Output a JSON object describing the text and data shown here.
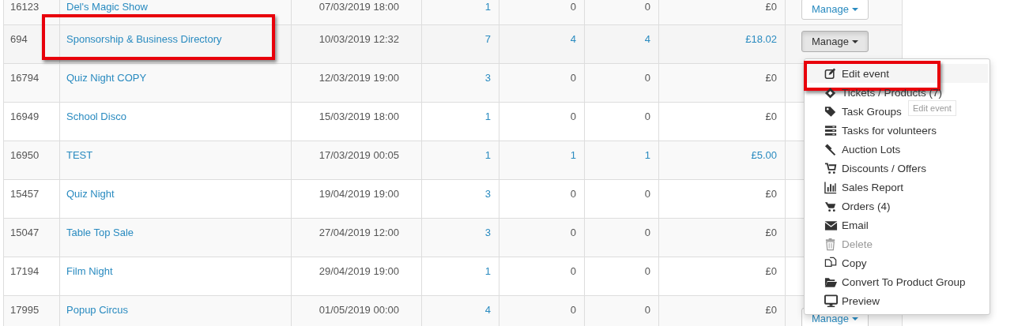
{
  "table": {
    "rows": [
      {
        "id": "16123",
        "name": "Del's Magic Show",
        "date": "07/03/2019 18:00",
        "counts": [
          {
            "text": "1",
            "link": true
          },
          {
            "text": "0",
            "link": false
          },
          {
            "text": "0",
            "link": false
          }
        ],
        "amount": {
          "text": "£0",
          "link": false
        },
        "hovered": false,
        "annotated": false,
        "manage": {
          "label": "Manage",
          "open": false
        }
      },
      {
        "id": "694",
        "name": "Sponsorship & Business Directory",
        "date": "10/03/2019 12:32",
        "counts": [
          {
            "text": "7",
            "link": true
          },
          {
            "text": "4",
            "link": true
          },
          {
            "text": "4",
            "link": true
          }
        ],
        "amount": {
          "text": "£18.02",
          "link": true
        },
        "hovered": true,
        "annotated": true,
        "manage": {
          "label": "Manage",
          "open": true
        }
      },
      {
        "id": "16794",
        "name": "Quiz Night COPY",
        "date": "12/03/2019 19:00",
        "counts": [
          {
            "text": "3",
            "link": true
          },
          {
            "text": "0",
            "link": false
          },
          {
            "text": "0",
            "link": false
          }
        ],
        "amount": {
          "text": "£0",
          "link": false
        },
        "hovered": false,
        "annotated": false
      },
      {
        "id": "16949",
        "name": "School Disco",
        "date": "15/03/2019 18:00",
        "counts": [
          {
            "text": "1",
            "link": true
          },
          {
            "text": "0",
            "link": false
          },
          {
            "text": "0",
            "link": false
          }
        ],
        "amount": {
          "text": "£0",
          "link": false
        },
        "hovered": false,
        "annotated": false
      },
      {
        "id": "16950",
        "name": "TEST",
        "date": "17/03/2019 00:05",
        "counts": [
          {
            "text": "1",
            "link": true
          },
          {
            "text": "1",
            "link": true
          },
          {
            "text": "1",
            "link": true
          }
        ],
        "amount": {
          "text": "£5.00",
          "link": true
        },
        "hovered": false,
        "annotated": false
      },
      {
        "id": "15457",
        "name": "Quiz Night",
        "date": "19/04/2019 19:00",
        "counts": [
          {
            "text": "3",
            "link": true
          },
          {
            "text": "0",
            "link": false
          },
          {
            "text": "0",
            "link": false
          }
        ],
        "amount": {
          "text": "£0",
          "link": false
        },
        "hovered": false,
        "annotated": false
      },
      {
        "id": "15047",
        "name": "Table Top Sale",
        "date": "27/04/2019 12:00",
        "counts": [
          {
            "text": "3",
            "link": true
          },
          {
            "text": "0",
            "link": false
          },
          {
            "text": "0",
            "link": false
          }
        ],
        "amount": {
          "text": "£0",
          "link": false
        },
        "hovered": false,
        "annotated": false
      },
      {
        "id": "17194",
        "name": "Film Night",
        "date": "29/04/2019 19:00",
        "counts": [
          {
            "text": "1",
            "link": true
          },
          {
            "text": "0",
            "link": false
          },
          {
            "text": "0",
            "link": false
          }
        ],
        "amount": {
          "text": "£0",
          "link": false
        },
        "hovered": false,
        "annotated": false
      },
      {
        "id": "17995",
        "name": "Popup Circus",
        "date": "01/05/2019 00:00",
        "counts": [
          {
            "text": "4",
            "link": true
          },
          {
            "text": "0",
            "link": false
          },
          {
            "text": "0",
            "link": false
          }
        ],
        "amount": {
          "text": "£0",
          "link": false
        },
        "hovered": false,
        "annotated": false,
        "manage": {
          "label": "Manage",
          "open": false
        }
      }
    ]
  },
  "menu": {
    "items": [
      {
        "label": "Edit event",
        "selected": true,
        "disabled": false,
        "annotated": true
      },
      {
        "label": "Tickets / Products (7)",
        "selected": false,
        "disabled": false,
        "annotated": false
      },
      {
        "label": "Task Groups",
        "selected": false,
        "disabled": false,
        "annotated": false
      },
      {
        "label": "Tasks for volunteers",
        "selected": false,
        "disabled": false,
        "annotated": false
      },
      {
        "label": "Auction Lots",
        "selected": false,
        "disabled": false,
        "annotated": false
      },
      {
        "label": "Discounts / Offers",
        "selected": false,
        "disabled": false,
        "annotated": false
      },
      {
        "label": "Sales Report",
        "selected": false,
        "disabled": false,
        "annotated": false
      },
      {
        "label": "Orders (4)",
        "selected": false,
        "disabled": false,
        "annotated": false
      },
      {
        "label": "Email",
        "selected": false,
        "disabled": false,
        "annotated": false
      },
      {
        "label": "Delete",
        "selected": false,
        "disabled": true,
        "annotated": false
      },
      {
        "label": "Copy",
        "selected": false,
        "disabled": false,
        "annotated": false
      },
      {
        "label": "Convert To Product Group",
        "selected": false,
        "disabled": false,
        "annotated": false
      },
      {
        "label": "Preview",
        "selected": false,
        "disabled": false,
        "annotated": false
      }
    ],
    "tooltip": "Edit event"
  }
}
